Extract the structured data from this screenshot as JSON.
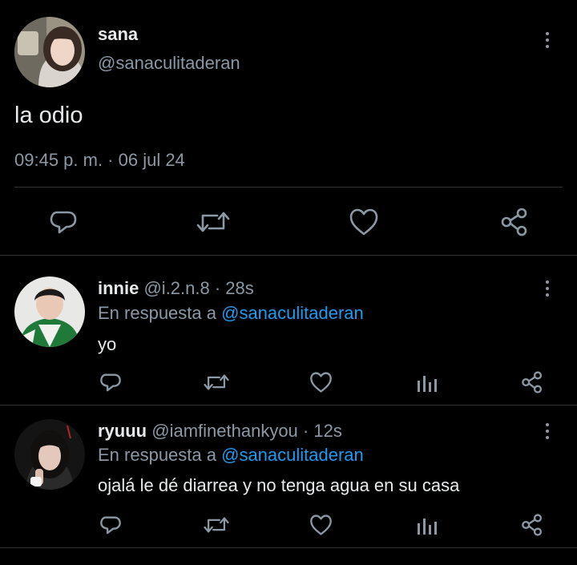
{
  "main_tweet": {
    "display_name": "sana",
    "handle": "@sanaculitaderan",
    "text": "la odio",
    "timestamp": "09:45 p. m. · 06 jul 24",
    "actions": [
      "reply-icon",
      "retweet-icon",
      "like-icon",
      "share-icon"
    ]
  },
  "replies": [
    {
      "display_name": "innie",
      "handle": "@i.2.n.8",
      "time": "· 28s",
      "reply_prefix": "En respuesta a",
      "reply_to": "@sanaculitaderan",
      "text": "yo"
    },
    {
      "display_name": "ryuuu",
      "handle": "@iamfinethankyou",
      "time": "· 12s",
      "reply_prefix": "En respuesta a",
      "reply_to": "@sanaculitaderan",
      "text": "ojalá le dé diarrea y no tenga agua en su casa"
    }
  ],
  "colors": {
    "background": "#000000",
    "text": "#e7e9ea",
    "muted": "#8b98a5",
    "link": "#1d9bf0",
    "divider": "#2f3336"
  }
}
